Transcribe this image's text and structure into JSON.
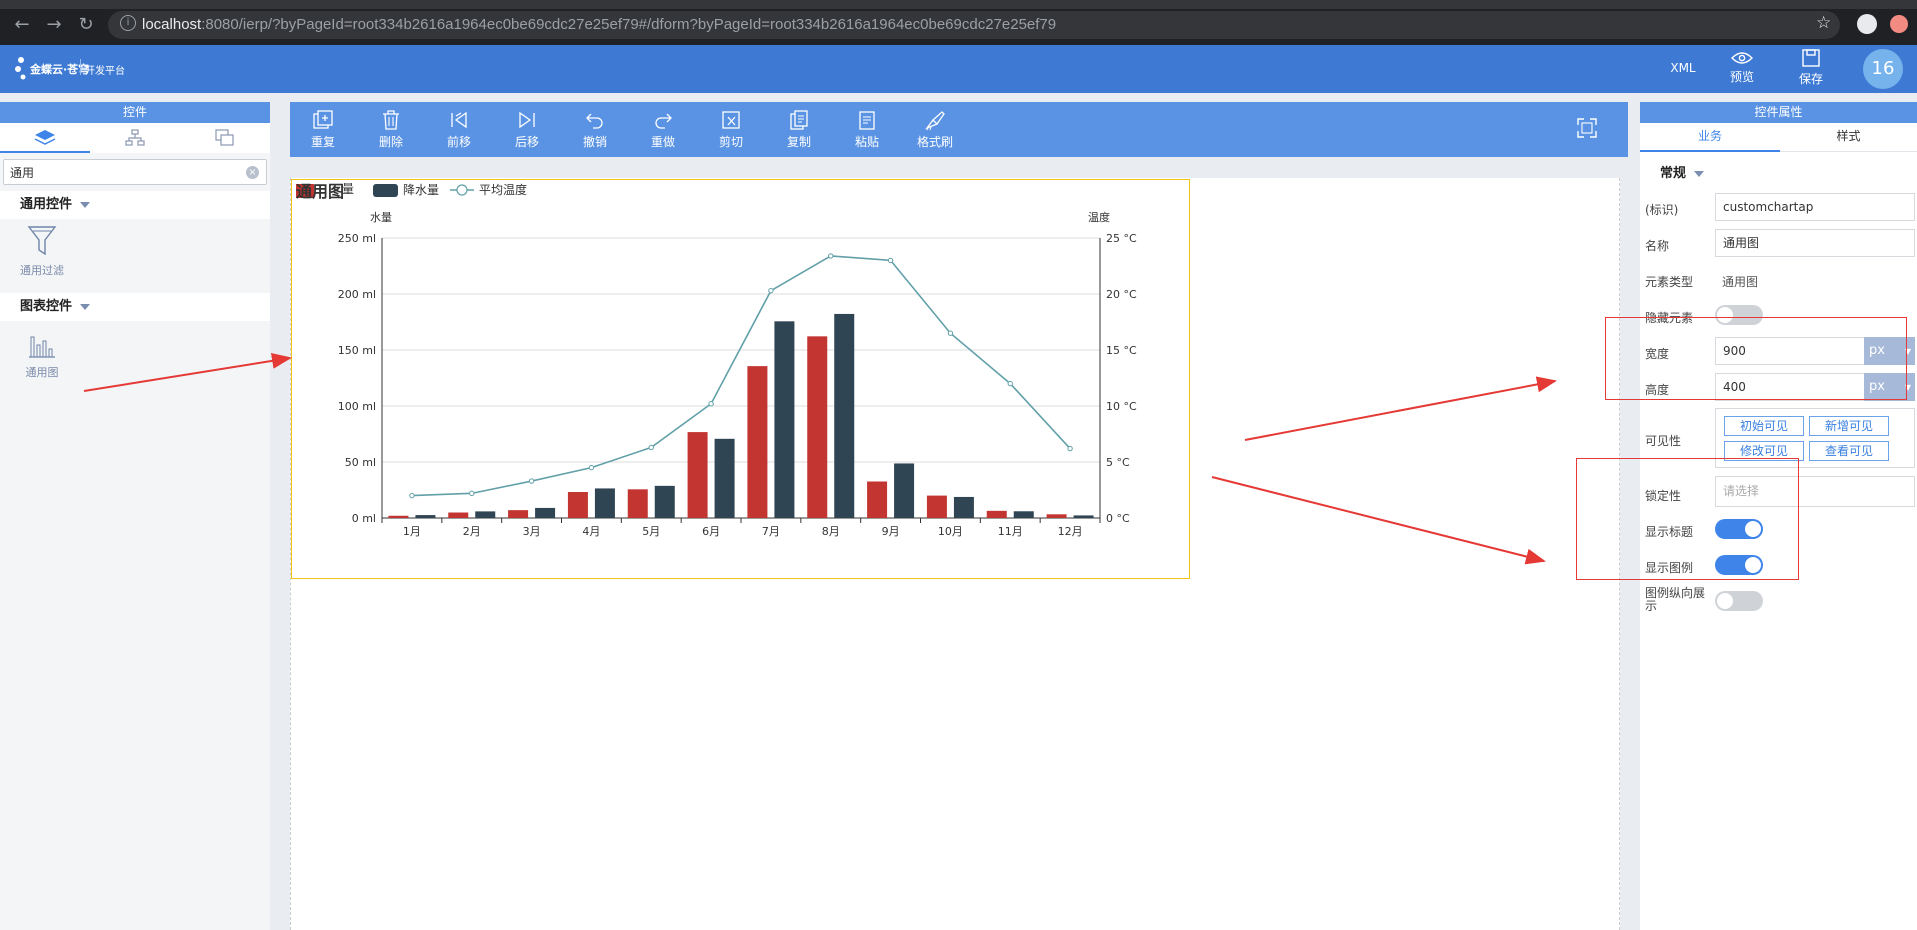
{
  "browser": {
    "url_host": "localhost",
    "url_rest": ":8080/ierp/?byPageId=root334b2616a1964ec0be69cdc27e25ef79#/dform?byPageId=root334b2616a1964ec0be69cdc27e25ef79"
  },
  "header": {
    "logo_brand": "金蝶云·苍穹",
    "logo_sub": "开发平台",
    "xml_label": "XML",
    "preview_label": "预览",
    "save_label": "保存",
    "avatar_text": "16"
  },
  "left_panel": {
    "title": "控件",
    "search_value": "通用",
    "groups": [
      {
        "label": "通用控件",
        "item": "通用过滤"
      },
      {
        "label": "图表控件",
        "item": "通用图"
      }
    ]
  },
  "toolbar": {
    "items": [
      "重复",
      "删除",
      "前移",
      "后移",
      "撤销",
      "重做",
      "剪切",
      "复制",
      "粘贴",
      "格式刷"
    ]
  },
  "chart_data": {
    "type": "bar",
    "title": "通用图",
    "legend_overlap_text": "量",
    "categories": [
      "1月",
      "2月",
      "3月",
      "4月",
      "5月",
      "6月",
      "7月",
      "8月",
      "9月",
      "10月",
      "11月",
      "12月"
    ],
    "series": [
      {
        "name": "蒸发量",
        "type": "bar",
        "color": "#c23531",
        "values": [
          2.0,
          4.9,
          7.0,
          23.2,
          25.6,
          76.7,
          135.6,
          162.2,
          32.6,
          20.0,
          6.4,
          3.3
        ]
      },
      {
        "name": "降水量",
        "type": "bar",
        "color": "#2f4554",
        "values": [
          2.6,
          5.9,
          9.0,
          26.4,
          28.7,
          70.7,
          175.6,
          182.2,
          48.7,
          18.8,
          6.0,
          2.3
        ]
      },
      {
        "name": "平均温度",
        "type": "line",
        "color": "#61a0a8",
        "axis": "right",
        "values": [
          2.0,
          2.2,
          3.3,
          4.5,
          6.3,
          10.2,
          20.3,
          23.4,
          23.0,
          16.5,
          12.0,
          6.2
        ]
      }
    ],
    "legend_names": [
      "降水量",
      "平均温度"
    ],
    "ylabel_left": "水量",
    "ylabel_right": "温度",
    "ylim_left": [
      0,
      250
    ],
    "ylim_right": [
      0,
      25
    ],
    "yticks_left": [
      "0 ml",
      "50 ml",
      "100 ml",
      "150 ml",
      "200 ml",
      "250 ml"
    ],
    "yticks_right": [
      "0 °C",
      "5 °C",
      "10 °C",
      "15 °C",
      "20 °C",
      "25 °C"
    ],
    "grid": true,
    "legend_position": "top-left"
  },
  "right_panel": {
    "title": "控件属性",
    "tabs": [
      "业务",
      "样式"
    ],
    "section": "常规",
    "props": {
      "key_label": "(标识)",
      "key_value": "customchartap",
      "name_label": "名称",
      "name_value": "通用图",
      "type_label": "元素类型",
      "type_value": "通用图",
      "hidden_label": "隐藏元素",
      "width_label": "宽度",
      "width_value": "900",
      "width_unit": "px",
      "height_label": "高度",
      "height_value": "400",
      "height_unit": "px",
      "visibility_label": "可见性",
      "visibility_buttons": [
        "初始可见",
        "新增可见",
        "修改可见",
        "查看可见"
      ],
      "lock_label": "锁定性",
      "lock_placeholder": "请选择",
      "show_title_label": "显示标题",
      "show_legend_label": "显示图例",
      "legend_vertical_label": "图例纵向展示"
    }
  }
}
